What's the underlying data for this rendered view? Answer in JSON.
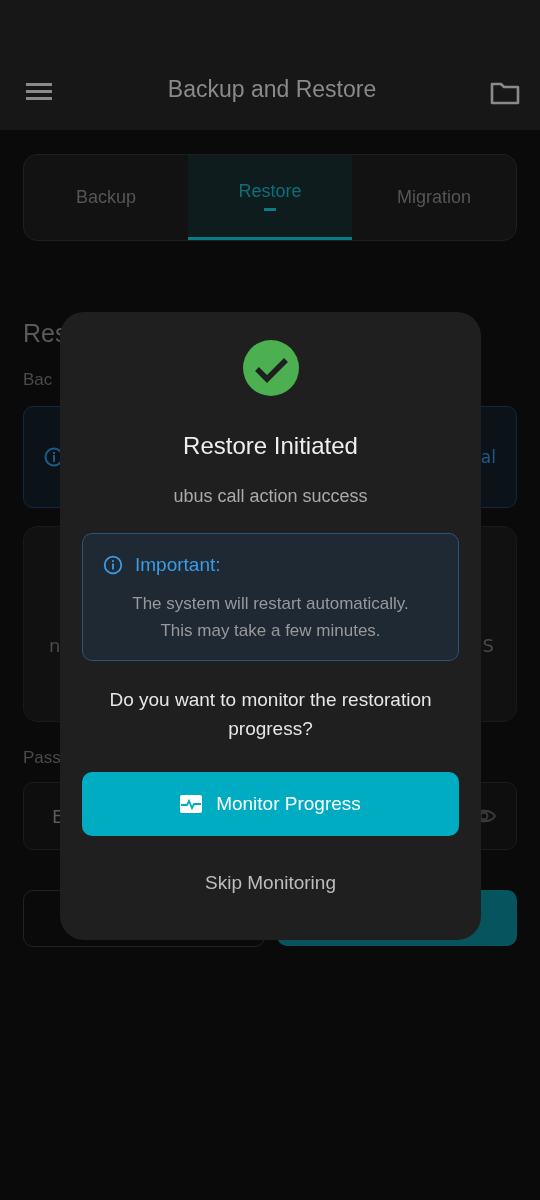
{
  "app_bar": {
    "title": "Backup and Restore"
  },
  "tabs": [
    {
      "label": "Backup",
      "selected": false
    },
    {
      "label": "Restore",
      "selected": true
    },
    {
      "label": "Migration",
      "selected": false
    }
  ],
  "background": {
    "section_title": "Res",
    "label": "Bac",
    "info_text": "al",
    "card_left_text": "n",
    "card_right_text": "S",
    "password_label": "Pass",
    "password_placeholder": "E"
  },
  "dialog": {
    "title": "Restore Initiated",
    "message": "ubus call action success",
    "notice": {
      "title": "Important:",
      "text": "The system will restart automatically. This may take a few minutes."
    },
    "question": "Do you want to monitor the restoration progress?",
    "primary_button": "Monitor Progress",
    "secondary_button": "Skip Monitoring"
  }
}
